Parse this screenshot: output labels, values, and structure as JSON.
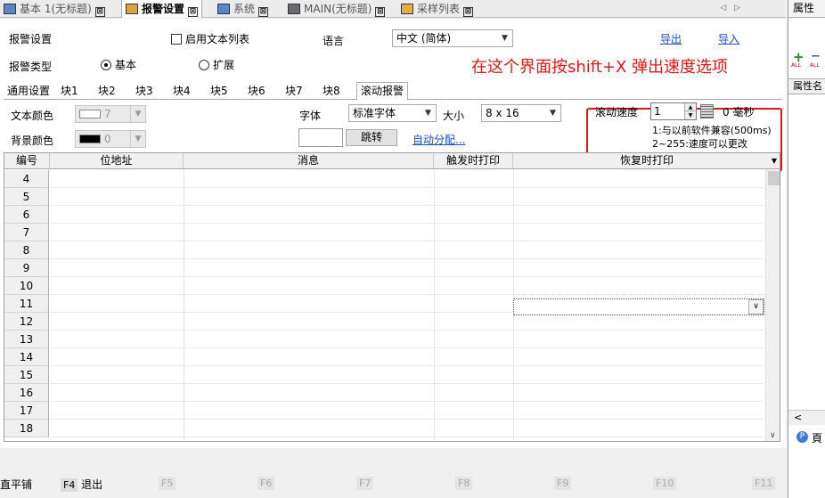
{
  "tabs": [
    {
      "label": "基本 1(无标题)",
      "active": false
    },
    {
      "label": "报警设置",
      "active": true
    },
    {
      "label": "系统",
      "active": false
    },
    {
      "label": "MAIN(无标题)",
      "active": false
    },
    {
      "label": "采样列表",
      "active": false
    }
  ],
  "tab_close_glyph": "⊠",
  "tab_nav": "◁ ▷",
  "right_panel": {
    "header": "属性",
    "sub_header": "属性名",
    "tool_label_1": "ALL",
    "tool_label_2": "ALL",
    "bottom_text": "頁"
  },
  "alarm": {
    "settings_label": "报警设置",
    "type_label": "报警类型",
    "enable_text_list": "启用文本列表",
    "type_basic": "基本",
    "type_extended": "扩展",
    "language_label": "语言",
    "language_value": "中文 (简体)",
    "export_link": "导出",
    "import_link": "导入"
  },
  "annotation": "在这个界面按shift+X 弹出速度选项",
  "subtabs": [
    "通用设置",
    "块1",
    "块2",
    "块3",
    "块4",
    "块5",
    "块6",
    "块7",
    "块8",
    "滚动报警"
  ],
  "active_subtab": "滚动报警",
  "scroll": {
    "text_color_label": "文本颜色",
    "text_color_value": "7",
    "bg_color_label": "背景颜色",
    "bg_color_value": "0",
    "font_label": "字体",
    "font_value": "标准字体",
    "size_label": "大小",
    "size_value": "8 x 16",
    "jump_input": "",
    "jump_button": "跳转",
    "auto_assign_link": "自动分配...",
    "speed_label": "滚动速度",
    "speed_value": "1",
    "speed_ms": "0 毫秒",
    "speed_note_1": "1:与以前软件兼容(500ms)",
    "speed_note_2": "2~255:速度可以更改"
  },
  "grid": {
    "columns": [
      "编号",
      "位地址",
      "消息",
      "触发时打印",
      "恢复时打印"
    ],
    "rows": [
      "4",
      "5",
      "6",
      "7",
      "8",
      "9",
      "10",
      "11",
      "12",
      "13",
      "14",
      "15",
      "16",
      "17",
      "18"
    ],
    "selected_row": "10"
  },
  "fkeys": {
    "partial_left": "直平铺",
    "f4": "F4",
    "f4_label": "退出",
    "others": [
      "F5",
      "F6",
      "F7",
      "F8",
      "F9",
      "F10",
      "F11"
    ]
  },
  "colors": {
    "accent_red": "#e01818",
    "link_blue": "#1a4fc4"
  }
}
